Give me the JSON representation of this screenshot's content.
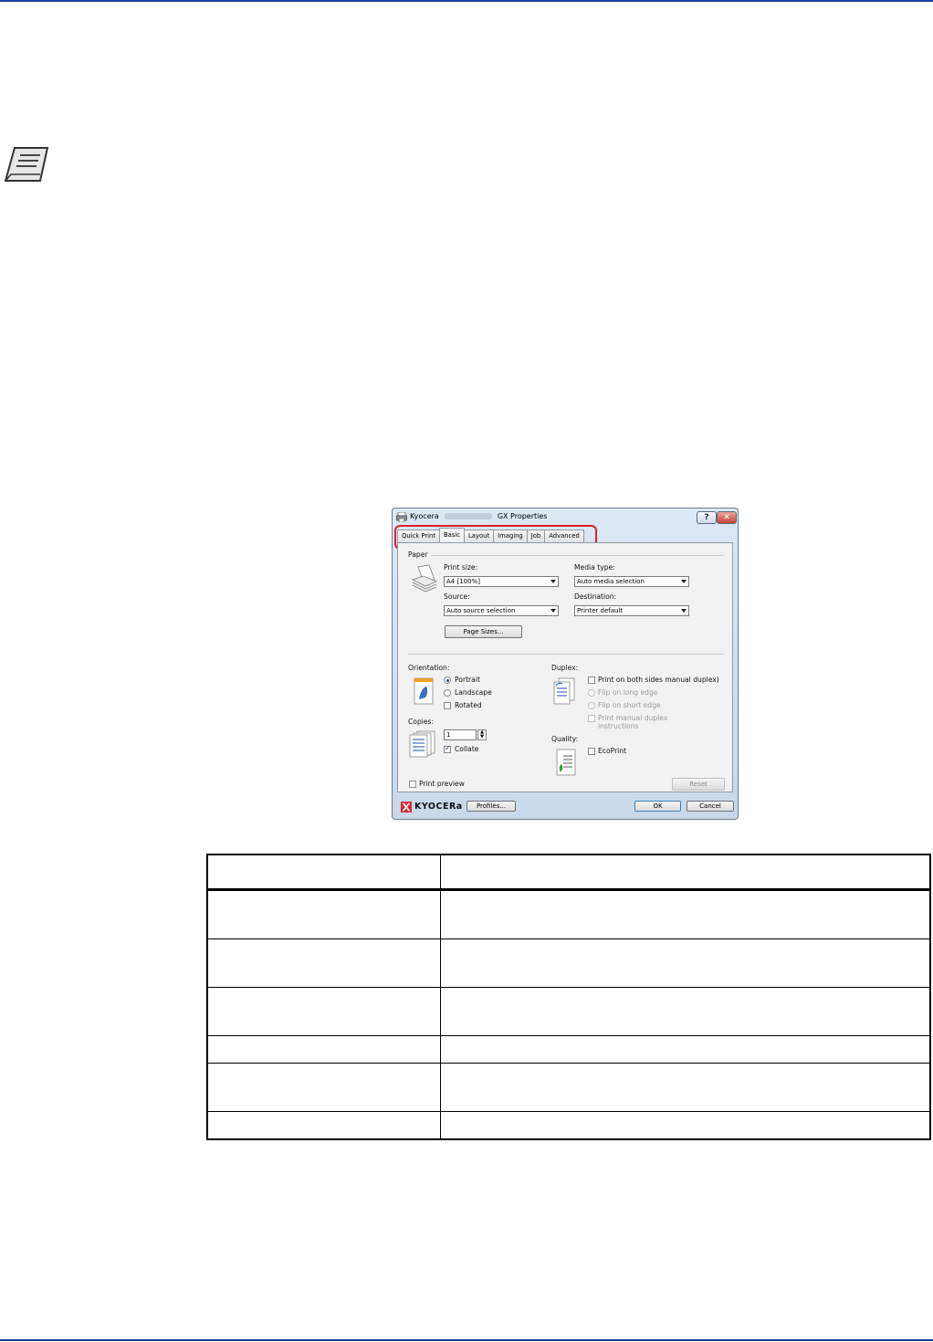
{
  "dialog": {
    "title_left": "Kyocera",
    "title_right": "GX Properties",
    "help_label": "?",
    "close_label": "✕",
    "tabs": [
      "Quick Print",
      "Basic",
      "Layout",
      "Imaging",
      "Job",
      "Advanced"
    ],
    "active_tab": "Basic",
    "paper": {
      "section_label": "Paper",
      "print_size_label": "Print size:",
      "print_size_value": "A4 [100%]",
      "media_type_label": "Media type:",
      "media_type_value": "Auto media selection",
      "source_label": "Source:",
      "source_value": "Auto source selection",
      "destination_label": "Destination:",
      "destination_value": "Printer default",
      "page_sizes_button": "Page Sizes..."
    },
    "orientation": {
      "label": "Orientation:",
      "portrait": "Portrait",
      "landscape": "Landscape",
      "rotated": "Rotated"
    },
    "duplex": {
      "label": "Duplex:",
      "both_sides": "Print on both sides manual duplex)",
      "flip_long": "Flip on long edge",
      "flip_short": "Flip on short edge",
      "manual_instructions_1": "Print manual duplex",
      "manual_instructions_2": "instructions"
    },
    "copies": {
      "label": "Copies:",
      "value": "1",
      "collate": "Collate"
    },
    "quality": {
      "label": "Quality:",
      "ecoprint": "EcoPrint"
    },
    "print_preview": "Print preview",
    "reset_button": "Reset",
    "brand": "KYOCERa",
    "profiles_button": "Profiles...",
    "ok_button": "OK",
    "cancel_button": "Cancel"
  },
  "table": {
    "header": [
      "",
      ""
    ],
    "rows": [
      [
        "",
        ""
      ],
      [
        "",
        ""
      ],
      [
        "",
        ""
      ],
      [
        "",
        ""
      ],
      [
        "",
        ""
      ],
      [
        "",
        ""
      ]
    ]
  },
  "colors": {
    "rule": "#1f3f9f",
    "highlight": "#e0202a",
    "brand_red": "#d8262f"
  }
}
